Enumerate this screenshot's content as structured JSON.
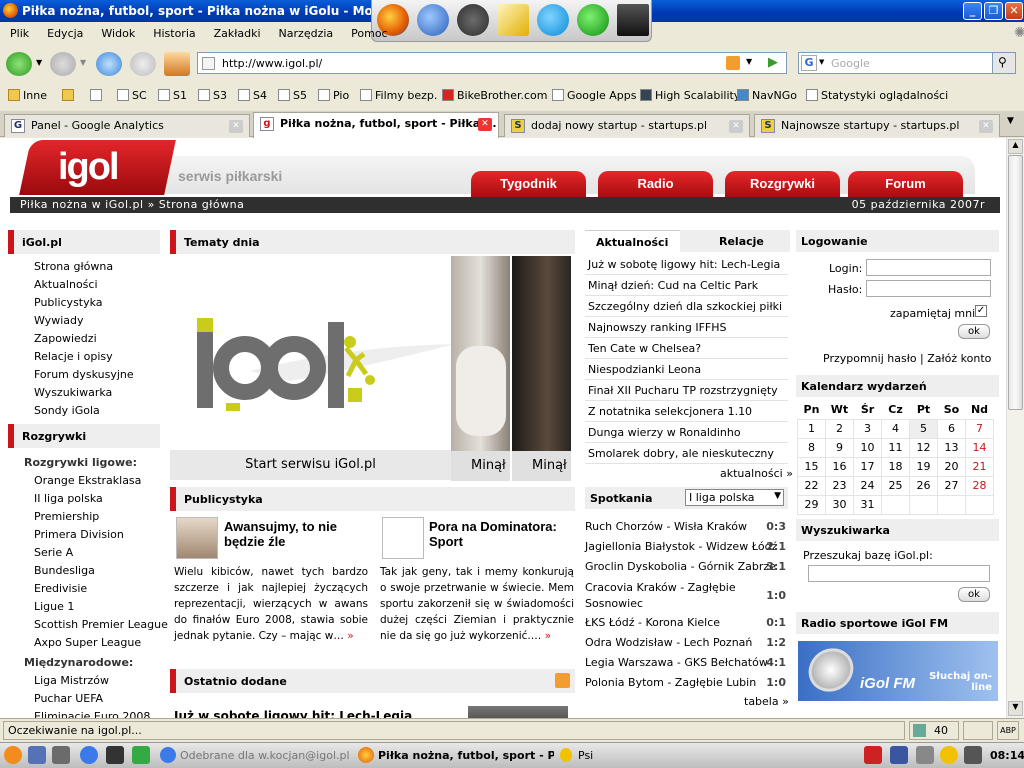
{
  "window": {
    "title": "Piłka nożna, futbol, sport - Piłka nożna w iGolu - Mozilla Firefox"
  },
  "menu": [
    "Plik",
    "Edycja",
    "Widok",
    "Historia",
    "Zakładki",
    "Narzędzia",
    "Pomoc"
  ],
  "nav": {
    "url": "http://www.igol.pl/",
    "search_placeholder": "Google"
  },
  "bookmarks": [
    "Inne",
    "SC",
    "S1",
    "S3",
    "S4",
    "S5",
    "Pio",
    "Filmy bezp.",
    "BikeBrother.com",
    "Google Apps",
    "High Scalability",
    "NavNGo",
    "Statystyki oglądalności"
  ],
  "tabs": [
    {
      "label": "Panel - Google Analytics",
      "icon": "G"
    },
    {
      "label": "Piłka nożna, futbol, sport - Piłka ...",
      "icon": "g"
    },
    {
      "label": "dodaj nowy startup - startups.pl",
      "icon": "S"
    },
    {
      "label": "Najnowsze startupy - startups.pl",
      "icon": "S"
    }
  ],
  "site": {
    "logo": "igol",
    "slogan": "serwis piłkarski",
    "navtabs": [
      "Tygodnik",
      "Radio",
      "Rozgrywki",
      "Forum"
    ],
    "breadcrumb": "Piłka nożna w iGol.pl » Strona główna",
    "date": "05 października 2007r"
  },
  "left": {
    "igol_head": "iGol.pl",
    "igol_links": [
      "Strona główna",
      "Aktualności",
      "Publicystyka",
      "Wywiady",
      "Zapowiedzi",
      "Relacje i opisy",
      "Forum dyskusyjne",
      "Wyszukiwarka",
      "Sondy iGola"
    ],
    "rozgrywki_head": "Rozgrywki",
    "ligowe_head": "Rozgrywki ligowe:",
    "ligowe": [
      "Orange Ekstraklasa",
      "II liga polska",
      "Premiership",
      "Primera Division",
      "Serie A",
      "Bundesliga",
      "Eredivisie",
      "Ligue 1",
      "Scottish Premier League",
      "Axpo Super League"
    ],
    "miedzy_head": "Międzynarodowe:",
    "miedzy": [
      "Liga Mistrzów",
      "Puchar UEFA",
      "Eliminacje Euro 2008"
    ]
  },
  "middle": {
    "tematy_head": "Tematy dnia",
    "featured_logo": "igol",
    "featured_caption": "Start serwisu iGol.pl",
    "mini_caps": [
      "Minął",
      "Minął"
    ],
    "publicystyka_head": "Publicystyka",
    "articles": [
      {
        "title": "Awansujmy, to nie będzie źle",
        "body": "Wielu kibiców, nawet tych bardzo szczerze i jak najlepiej życzących reprezentacji, wierzących w awans do finałów Euro 2008, stawia sobie jednak pytanie. Czy – mając w…",
        "more": "»"
      },
      {
        "title": "Pora na Dominatora: Sport",
        "body": "Tak jak geny, tak i memy konkurują o swoje przetrwanie w świecie. Mem sportu zakorzenił się w świadomości dużej części Ziemian i praktycznie nie da się go już wykorzenić.…",
        "more": "»"
      }
    ],
    "ostatnio_head": "Ostatnio dodane",
    "ostatnio_first": "Już w sobotę ligowy hit: Lech-Legia"
  },
  "news": {
    "tab_active": "Aktualności",
    "tab_other": "Relacje",
    "items": [
      "Już w sobotę ligowy hit: Lech-Legia",
      "Minął dzień: Cud na Celtic Park",
      "Szczególny dzień dla szkockiej piłki",
      "Najnowszy ranking IFFHS",
      "Ten Cate w Chelsea?",
      "Niespodzianki Leona",
      "Finał XII Pucharu TP rozstrzygnięty",
      "Z notatnika selekcjonera 1.10",
      "Dunga wierzy w Ronaldinho",
      "Smolarek dobry, ale nieskuteczny"
    ],
    "more": "aktualności »"
  },
  "matches": {
    "head": "Spotkania",
    "league": "I liga polska",
    "rows": [
      {
        "teams": "Ruch Chorzów - Wisła Kraków",
        "score": "0:3"
      },
      {
        "teams": "Jagiellonia Białystok - Widzew Łódź",
        "score": "2:1"
      },
      {
        "teams": "Groclin Dyskobolia - Górnik Zabrze",
        "score": "3:1"
      },
      {
        "teams": "Cracovia Kraków - Zagłębie Sosnowiec",
        "score": "1:0"
      },
      {
        "teams": "ŁKS Łódź - Korona Kielce",
        "score": "0:1"
      },
      {
        "teams": "Odra Wodzisław - Lech Poznań",
        "score": "1:2"
      },
      {
        "teams": "Legia Warszawa - GKS Bełchatów",
        "score": "4:1"
      },
      {
        "teams": "Polonia Bytom - Zagłębie Lubin",
        "score": "1:0"
      }
    ],
    "more": "tabela »"
  },
  "login": {
    "head": "Logowanie",
    "login_label": "Login:",
    "pass_label": "Hasło:",
    "remember": "zapamiętaj mnie",
    "ok": "ok",
    "links": "Przypomnij hasło | Załóż konto"
  },
  "calendar": {
    "head": "Kalendarz wydarzeń",
    "days": [
      "Pn",
      "Wt",
      "Śr",
      "Cz",
      "Pt",
      "So",
      "Nd"
    ],
    "weeks": [
      [
        "1",
        "2",
        "3",
        "4",
        "5",
        "6",
        "7"
      ],
      [
        "8",
        "9",
        "10",
        "11",
        "12",
        "13",
        "14"
      ],
      [
        "15",
        "16",
        "17",
        "18",
        "19",
        "20",
        "21"
      ],
      [
        "22",
        "23",
        "24",
        "25",
        "26",
        "27",
        "28"
      ],
      [
        "29",
        "30",
        "31",
        "",
        "",
        "",
        ""
      ]
    ]
  },
  "search": {
    "head": "Wyszukiwarka",
    "label": "Przeszukaj bazę iGol.pl:",
    "ok": "ok"
  },
  "radio": {
    "head": "Radio sportowe iGol FM",
    "banner_logo": "iGol FM",
    "banner_text": "Słuchaj on-line"
  },
  "status": {
    "text": "Oczekiwanie na igol.pl...",
    "count": "40"
  },
  "taskbar": {
    "items": [
      "Odebrane dla w.kocjan@igol.pl - Thu",
      "Piłka nożna, futbol, sport - Piłka",
      "Psi"
    ],
    "clock": "08:14"
  },
  "colors": {
    "brand_red": "#c8161b",
    "xp_blue": "#0a5fd8"
  }
}
